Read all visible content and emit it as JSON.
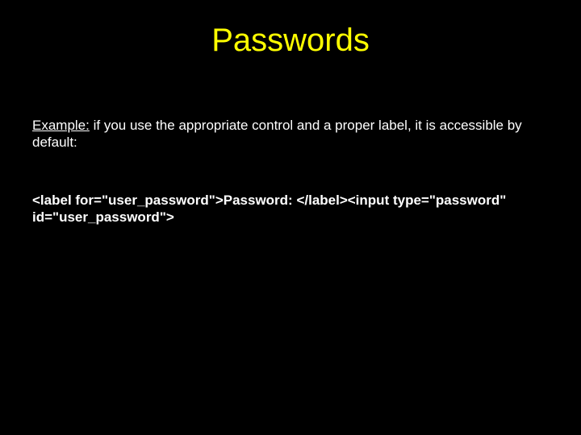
{
  "slide": {
    "title": "Passwords",
    "example_label": "Example:",
    "example_text": " if you use the appropriate control and a proper label, it is accessible by default:",
    "code_snippet": "<label for=\"user_password\">Password: </label><input type=\"password\" id=\"user_password\">"
  }
}
